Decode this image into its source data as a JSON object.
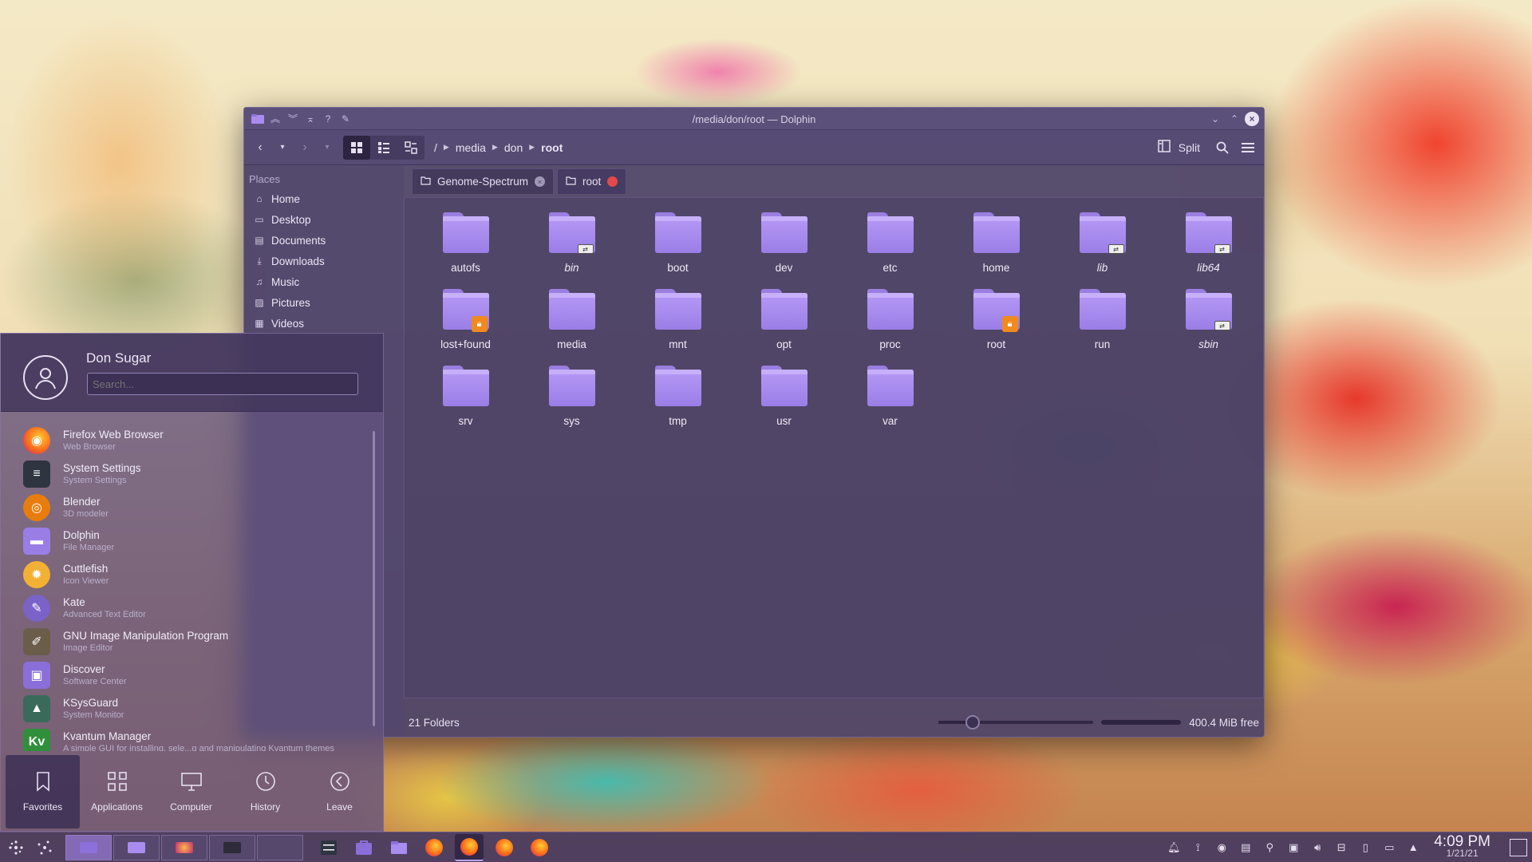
{
  "window": {
    "title": "/media/don/root — Dolphin"
  },
  "toolbar": {
    "breadcrumb": [
      "/",
      "media",
      "don",
      "root"
    ],
    "split_label": "Split"
  },
  "places": {
    "title": "Places",
    "items": [
      {
        "label": "Home",
        "icon": "home-icon"
      },
      {
        "label": "Desktop",
        "icon": "desktop-icon"
      },
      {
        "label": "Documents",
        "icon": "documents-icon"
      },
      {
        "label": "Downloads",
        "icon": "downloads-icon"
      },
      {
        "label": "Music",
        "icon": "music-icon"
      },
      {
        "label": "Pictures",
        "icon": "pictures-icon"
      },
      {
        "label": "Videos",
        "icon": "videos-icon"
      }
    ]
  },
  "tabs": [
    {
      "label": "Genome-Spectrum",
      "active": false
    },
    {
      "label": "root",
      "active": true
    }
  ],
  "folders": [
    {
      "name": "autofs",
      "badge": "",
      "italic": false
    },
    {
      "name": "bin",
      "badge": "link",
      "italic": true
    },
    {
      "name": "boot",
      "badge": "",
      "italic": false
    },
    {
      "name": "dev",
      "badge": "",
      "italic": false
    },
    {
      "name": "etc",
      "badge": "",
      "italic": false
    },
    {
      "name": "home",
      "badge": "",
      "italic": false
    },
    {
      "name": "lib",
      "badge": "link",
      "italic": true
    },
    {
      "name": "lib64",
      "badge": "link",
      "italic": true
    },
    {
      "name": "lost+found",
      "badge": "lock",
      "italic": false
    },
    {
      "name": "media",
      "badge": "",
      "italic": false
    },
    {
      "name": "mnt",
      "badge": "",
      "italic": false
    },
    {
      "name": "opt",
      "badge": "",
      "italic": false
    },
    {
      "name": "proc",
      "badge": "",
      "italic": false
    },
    {
      "name": "root",
      "badge": "lock",
      "italic": false
    },
    {
      "name": "run",
      "badge": "",
      "italic": false
    },
    {
      "name": "sbin",
      "badge": "link",
      "italic": true
    },
    {
      "name": "srv",
      "badge": "",
      "italic": false
    },
    {
      "name": "sys",
      "badge": "",
      "italic": false
    },
    {
      "name": "tmp",
      "badge": "",
      "italic": false
    },
    {
      "name": "usr",
      "badge": "",
      "italic": false
    },
    {
      "name": "var",
      "badge": "",
      "italic": false
    }
  ],
  "statusbar": {
    "count": "21 Folders",
    "free_space": "400.4 MiB free",
    "zoom_level": 0.22
  },
  "launcher": {
    "user_name": "Don Sugar",
    "search_placeholder": "Search...",
    "apps": [
      {
        "name": "Firefox Web Browser",
        "desc": "Web Browser",
        "icon": "firefox-icon",
        "color": "#ff6a1a"
      },
      {
        "name": "System Settings",
        "desc": "System Settings",
        "icon": "settings-icon",
        "color": "#2e3440"
      },
      {
        "name": "Blender",
        "desc": "3D modeler",
        "icon": "blender-icon",
        "color": "#e87d0d"
      },
      {
        "name": "Dolphin",
        "desc": "File Manager",
        "icon": "folder-icon",
        "color": "#9a7ee6"
      },
      {
        "name": "Cuttlefish",
        "desc": "Icon Viewer",
        "icon": "cuttlefish-icon",
        "color": "#f2b134"
      },
      {
        "name": "Kate",
        "desc": "Advanced Text Editor",
        "icon": "kate-icon",
        "color": "#7a62c9"
      },
      {
        "name": "GNU Image Manipulation Program",
        "desc": "Image Editor",
        "icon": "gimp-icon",
        "color": "#6a5d4a"
      },
      {
        "name": "Discover",
        "desc": "Software Center",
        "icon": "discover-icon",
        "color": "#8a6fd8"
      },
      {
        "name": "KSysGuard",
        "desc": "System Monitor",
        "icon": "ksysguard-icon",
        "color": "#3a6a5a"
      },
      {
        "name": "Kvantum Manager",
        "desc": "A simple GUI for installing, sele...q and manipulating Kvantum themes",
        "icon": "kvantum-icon",
        "color": "#2f8f3a"
      }
    ],
    "nav": [
      {
        "label": "Favorites",
        "icon": "bookmark-icon",
        "active": true
      },
      {
        "label": "Applications",
        "icon": "grid-icon",
        "active": false
      },
      {
        "label": "Computer",
        "icon": "monitor-icon",
        "active": false
      },
      {
        "label": "History",
        "icon": "clock-icon",
        "active": false
      },
      {
        "label": "Leave",
        "icon": "arrow-left-icon",
        "active": false
      }
    ]
  },
  "taskbar": {
    "time": "4:09 PM",
    "date": "1/21/21"
  }
}
